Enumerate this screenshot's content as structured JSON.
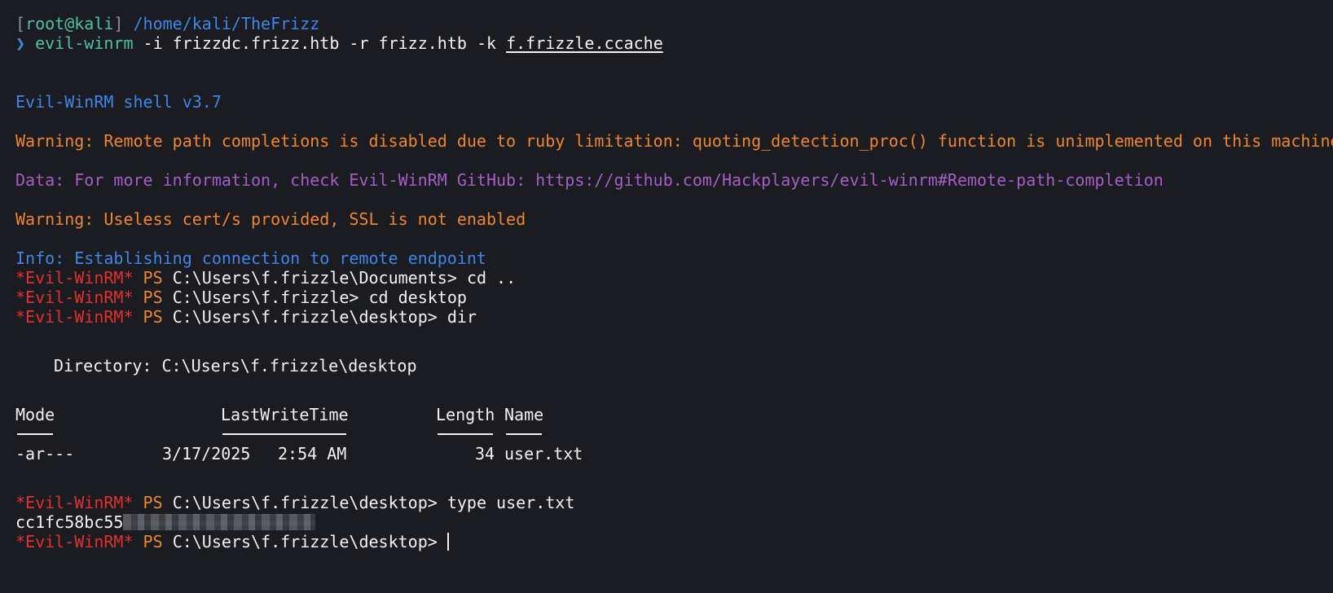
{
  "prompt": {
    "bracket_open": "[",
    "user_host": "root@kali",
    "bracket_close": "]",
    "path": "/home/kali/TheFrizz",
    "arrow": "❯",
    "command_name": "evil-winrm",
    "command_args": " -i frizzdc.frizz.htb -r frizz.htb -k ",
    "command_file": "f.frizzle.ccache"
  },
  "output": {
    "banner": "Evil-WinRM shell v3.7",
    "warning1": "Warning: Remote path completions is disabled due to ruby limitation: quoting_detection_proc() function is unimplemented on this machine",
    "data_line": "Data: For more information, check Evil-WinRM GitHub: https://github.com/Hackplayers/evil-winrm#Remote-path-completion",
    "warning2": "Warning: Useless cert/s provided, SSL is not enabled",
    "info": "Info: Establishing connection to remote endpoint"
  },
  "ps": {
    "tag": "*Evil-WinRM*",
    "ps_label": "PS",
    "lines": [
      {
        "path": "C:\\Users\\f.frizzle\\Documents>",
        "cmd": "cd .."
      },
      {
        "path": "C:\\Users\\f.frizzle>",
        "cmd": "cd desktop"
      },
      {
        "path": "C:\\Users\\f.frizzle\\desktop>",
        "cmd": "dir"
      }
    ],
    "type_line": {
      "path": "C:\\Users\\f.frizzle\\desktop>",
      "cmd": "type user.txt"
    },
    "final_prompt": {
      "path": "C:\\Users\\f.frizzle\\desktop>",
      "cmd": ""
    }
  },
  "directory": {
    "label": "Directory: C:\\Users\\f.frizzle\\desktop"
  },
  "listing": {
    "headers": {
      "mode": "Mode",
      "lastwritetime": "LastWriteTime",
      "length": "Length",
      "name": "Name"
    },
    "rows": [
      {
        "mode": "-ar---",
        "date": "3/17/2025",
        "time": "2:54 AM",
        "length": "34",
        "name": "user.txt"
      }
    ]
  },
  "flag": {
    "visible_prefix": "cc1fc58bc55"
  }
}
